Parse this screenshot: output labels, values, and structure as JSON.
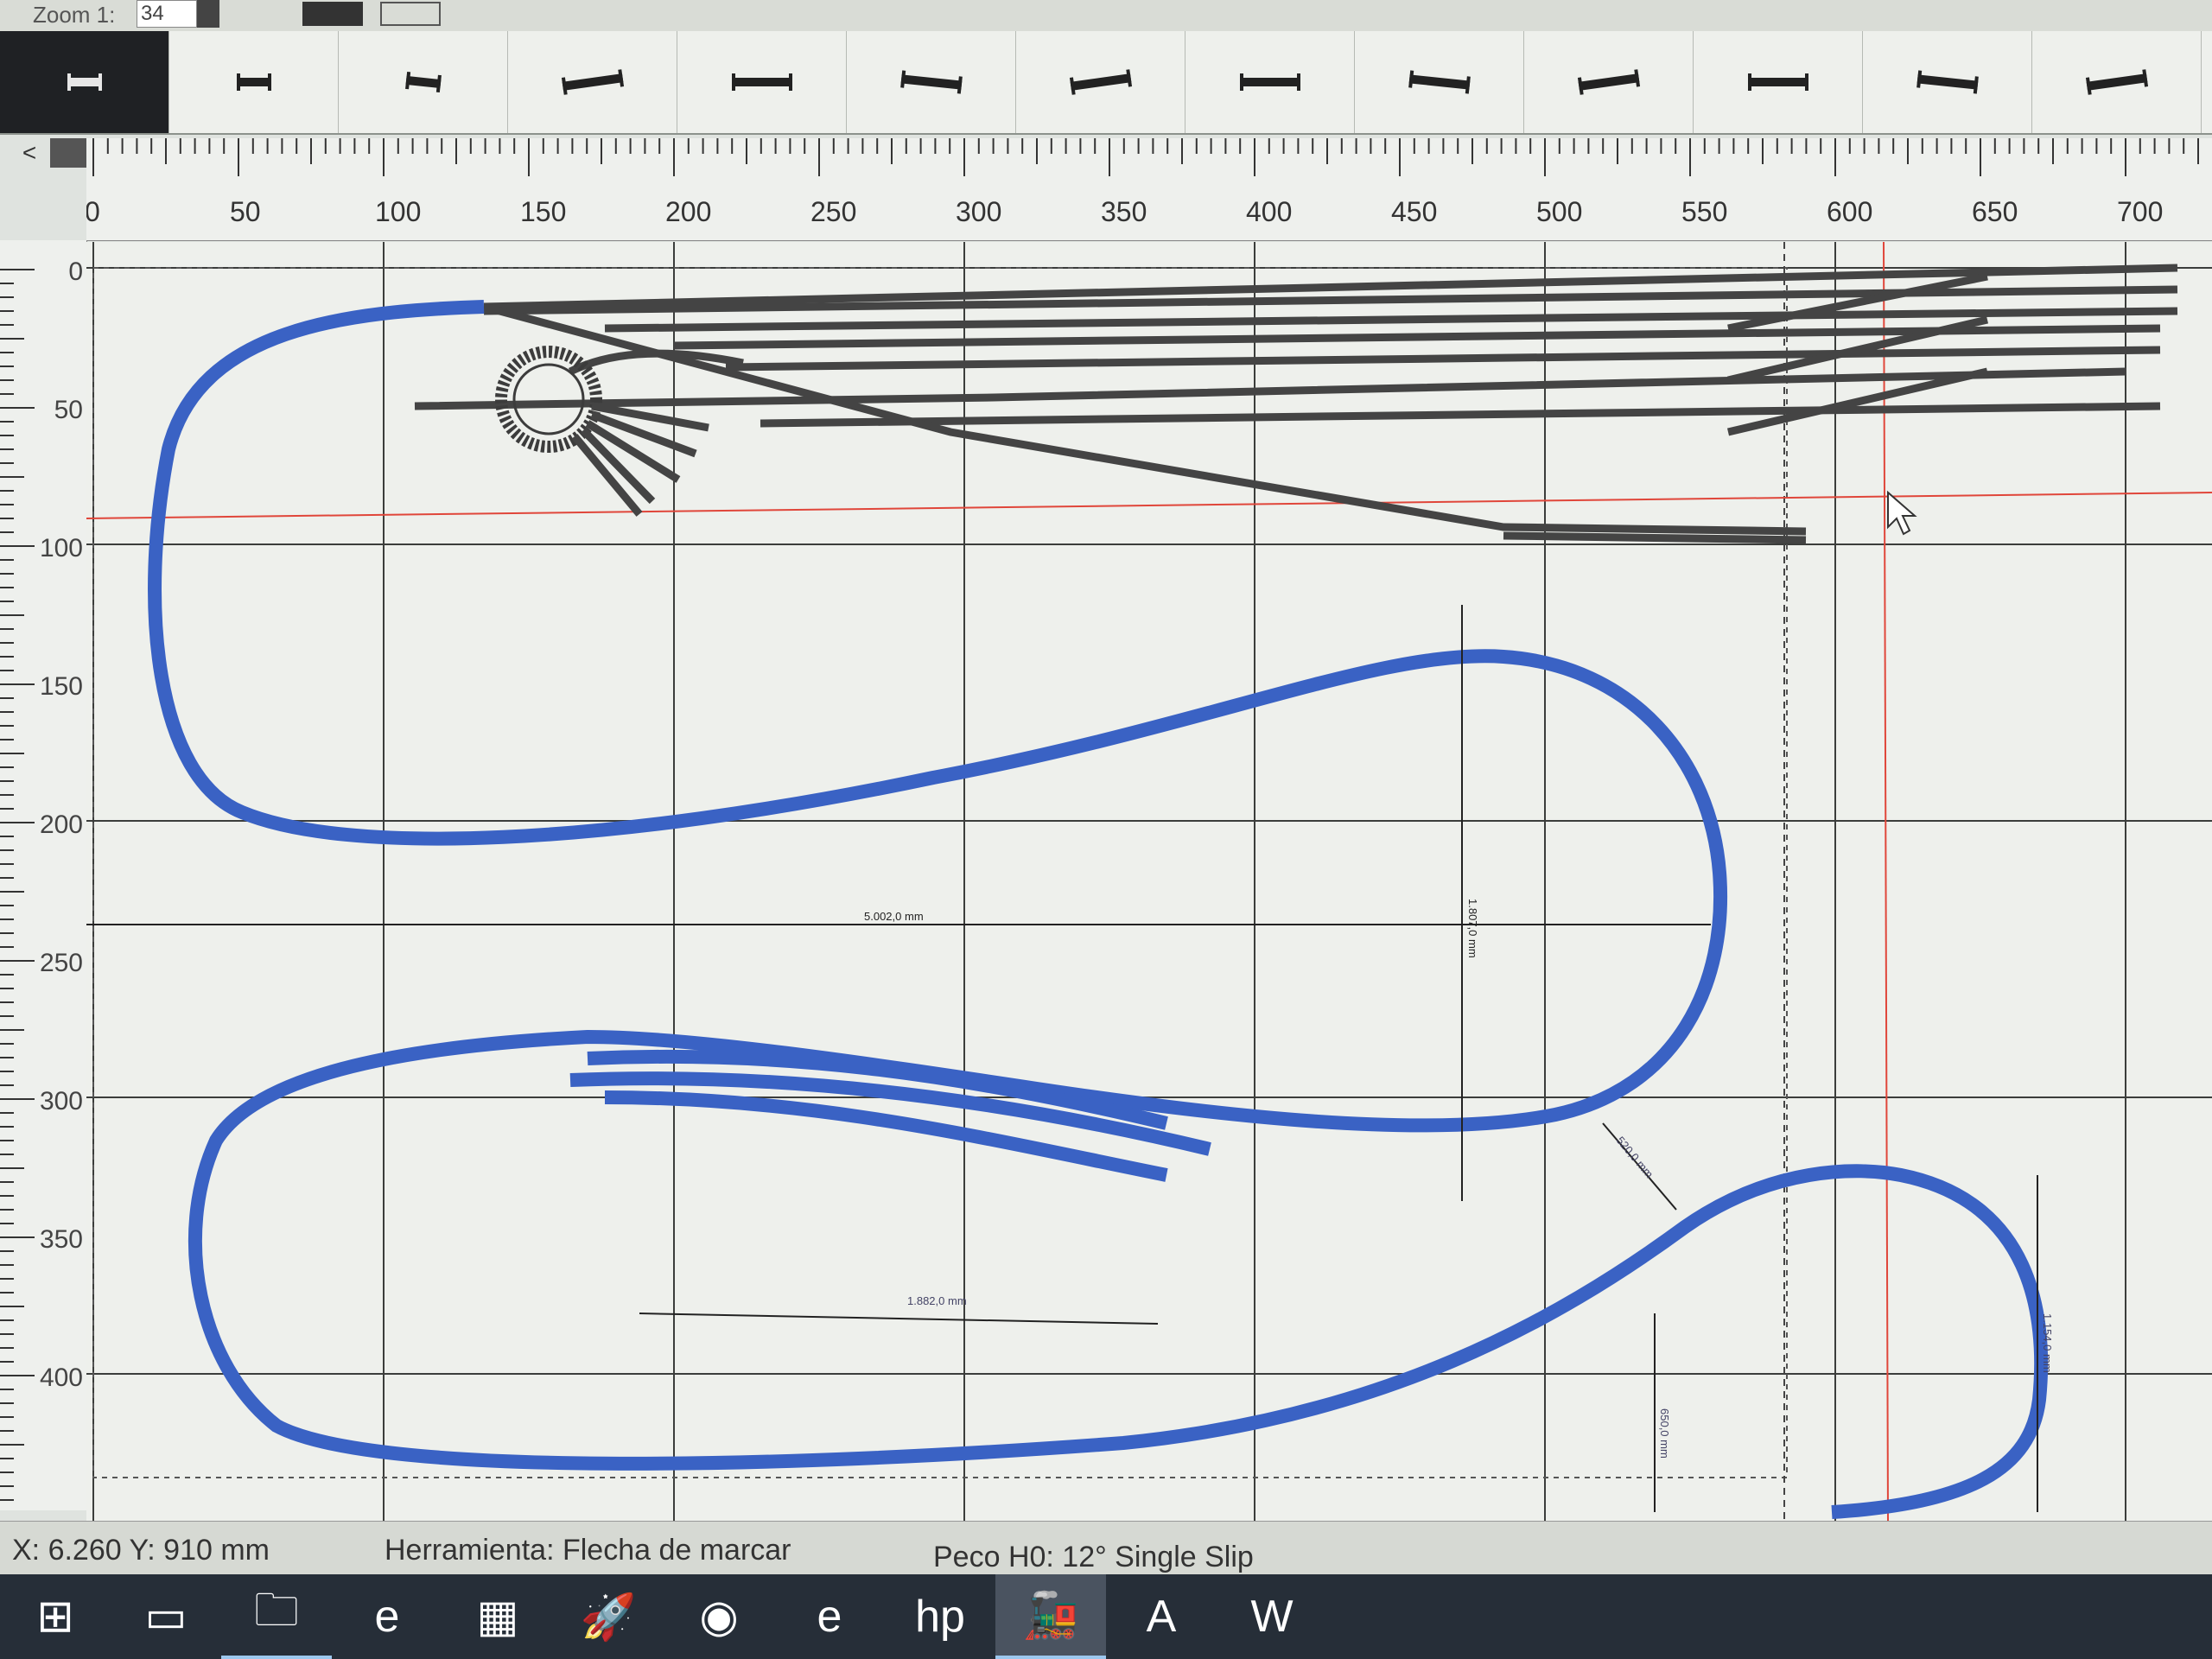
{
  "toolbar": {
    "zoom_label": "Zoom 1:",
    "zoom_value": "34"
  },
  "palette": {
    "items": [
      {
        "name": "track-piece-1",
        "selected": true
      },
      {
        "name": "track-piece-2"
      },
      {
        "name": "track-piece-3"
      },
      {
        "name": "track-piece-4"
      },
      {
        "name": "track-piece-5"
      },
      {
        "name": "track-piece-6"
      },
      {
        "name": "track-piece-7"
      },
      {
        "name": "track-piece-8"
      },
      {
        "name": "track-piece-9"
      },
      {
        "name": "track-piece-10"
      },
      {
        "name": "track-piece-11"
      },
      {
        "name": "track-piece-12"
      },
      {
        "name": "track-piece-13"
      }
    ]
  },
  "rulers": {
    "horizontal_labels": [
      "0",
      "50",
      "100",
      "150",
      "200",
      "250",
      "300",
      "350",
      "400",
      "450",
      "500",
      "550",
      "600",
      "650",
      "700"
    ],
    "vertical_labels": [
      "0",
      "50",
      "100",
      "150",
      "200",
      "250",
      "300",
      "350",
      "400"
    ]
  },
  "canvas": {
    "dimensions": {
      "top_loop_width": "5.002,0 mm",
      "right_loop_height": "1.807,0 mm",
      "bottom_width": "1.882,0 mm",
      "diagonal": "520,0 mm",
      "small_height": "650,0 mm",
      "right_small_height": "1.154,0 mm"
    },
    "colors": {
      "track_selected": "#3a62c4",
      "track_normal": "#4a4a4a",
      "guide_red": "#e0463a",
      "grid": "#3b3d3b"
    }
  },
  "status": {
    "coords": "X: 6.260   Y: 910 mm",
    "tool": "Herramienta: Flecha de marcar",
    "piece": "Peco H0: 12° Single Slip"
  },
  "taskbar": {
    "icons": [
      {
        "name": "windows-start-icon",
        "glyph": "⊞"
      },
      {
        "name": "task-view-icon",
        "glyph": "▭"
      },
      {
        "name": "file-explorer-icon",
        "glyph": "🗀"
      },
      {
        "name": "edge-icon",
        "glyph": "e"
      },
      {
        "name": "store-icon",
        "glyph": "▦"
      },
      {
        "name": "rocket-app-icon",
        "glyph": "🚀"
      },
      {
        "name": "chrome-icon",
        "glyph": "◉"
      },
      {
        "name": "internet-explorer-icon",
        "glyph": "e"
      },
      {
        "name": "hp-icon",
        "glyph": "hp"
      },
      {
        "name": "train-app-icon",
        "glyph": "🚂",
        "active": true
      },
      {
        "name": "acrobat-icon",
        "glyph": "A"
      },
      {
        "name": "word-icon",
        "glyph": "W"
      }
    ]
  }
}
